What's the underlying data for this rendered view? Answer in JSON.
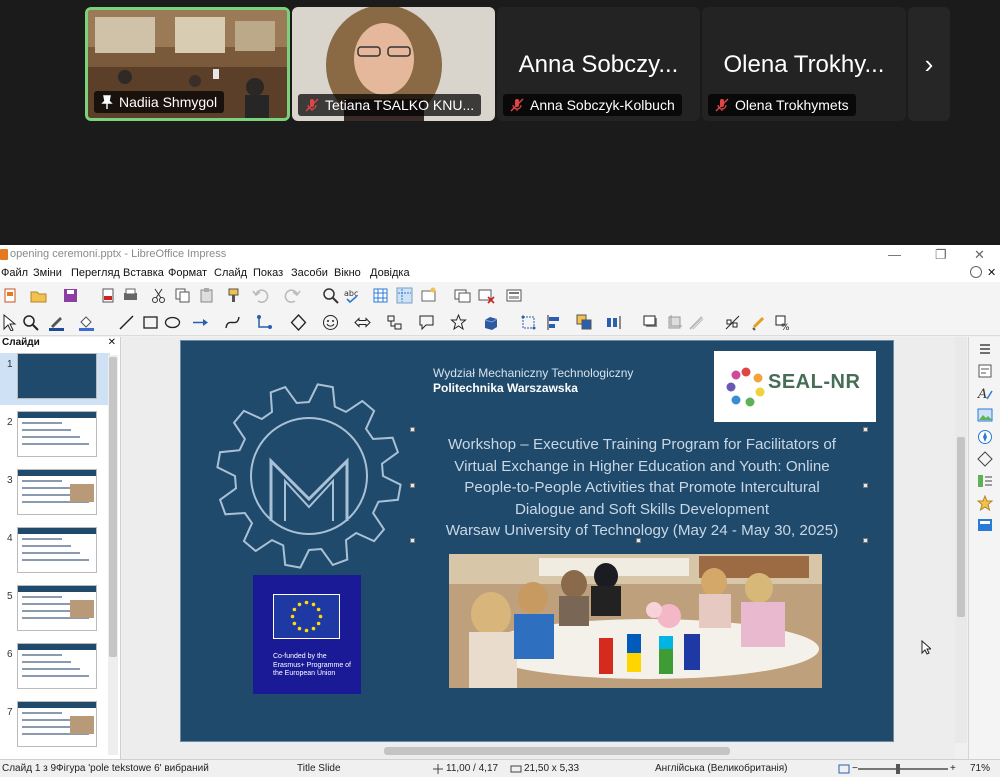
{
  "call": {
    "participants": [
      {
        "name": "Nadiia Shmygol",
        "pinned": true,
        "active": true
      },
      {
        "name": "Tetiana TSALKO KNU...",
        "muted": true
      },
      {
        "name": "Anna Sobczyk-Kolbuch",
        "display": "Anna Sobczy...",
        "muted": true
      },
      {
        "name": "Olena Trokhymets",
        "display": "Olena Trokhy...",
        "muted": true
      }
    ],
    "next_label": "›"
  },
  "window": {
    "title": "opening ceremoni.pptx - LibreOffice Impress"
  },
  "menu": [
    "Файл",
    "Зміни",
    "Перегляд",
    "Вставка",
    "Формат",
    "Слайд",
    "Показ",
    "Засоби",
    "Вікно",
    "Довідка"
  ],
  "slides_panel": {
    "title": "Слайди",
    "count": 7,
    "selected": 1
  },
  "slide": {
    "faculty_line1": "Wydział Mechaniczny Technologiczny",
    "faculty_line2": "Politechnika Warszawska",
    "logo_text": "SEAL-NR",
    "title_lines": [
      "Workshop – Executive Training Program for Facilitators of",
      "Virtual Exchange in Higher Education and Youth: Online",
      "People-to-People Activities that Promote Intercultural",
      "Dialogue and Soft Skills Development",
      "Warsaw University of Technology (May 24 - May 30, 2025)"
    ],
    "eu_text": "Co-funded by the Erasmus+ Programme of the European Union"
  },
  "status": {
    "slide_of": "Слайд 1 з 9",
    "selection": "Фігура 'pole tekstowe 6' вибраний",
    "layout": "Title Slide",
    "position": "11,00 / 4,17",
    "size": "21,50 x 5,33",
    "language": "Англійська (Великобританія)",
    "zoom": "71%"
  },
  "colors": {
    "slide_bg": "#1f4a6b",
    "active_speaker": "#7bd27b",
    "eu_blue": "#1a1a96",
    "seal_green": "#466e56"
  }
}
